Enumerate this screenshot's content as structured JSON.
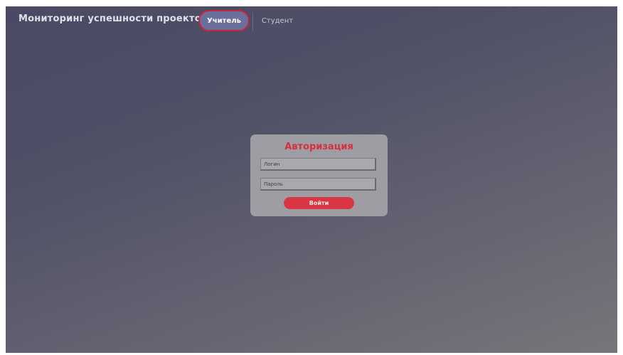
{
  "header": {
    "title": "Мониторинг успешности проектов",
    "tabs": [
      {
        "label": "Учитель",
        "active": true
      },
      {
        "label": "Студент",
        "active": false
      }
    ]
  },
  "login": {
    "title": "Авторизация",
    "login_placeholder": "Логин",
    "password_placeholder": "Пароль",
    "submit_label": "Войти"
  },
  "colors": {
    "accent": "#d83642",
    "active_tab_bg": "#6b6f9c",
    "active_tab_border": "#c8243a",
    "card_bg": "#9d9da3"
  }
}
